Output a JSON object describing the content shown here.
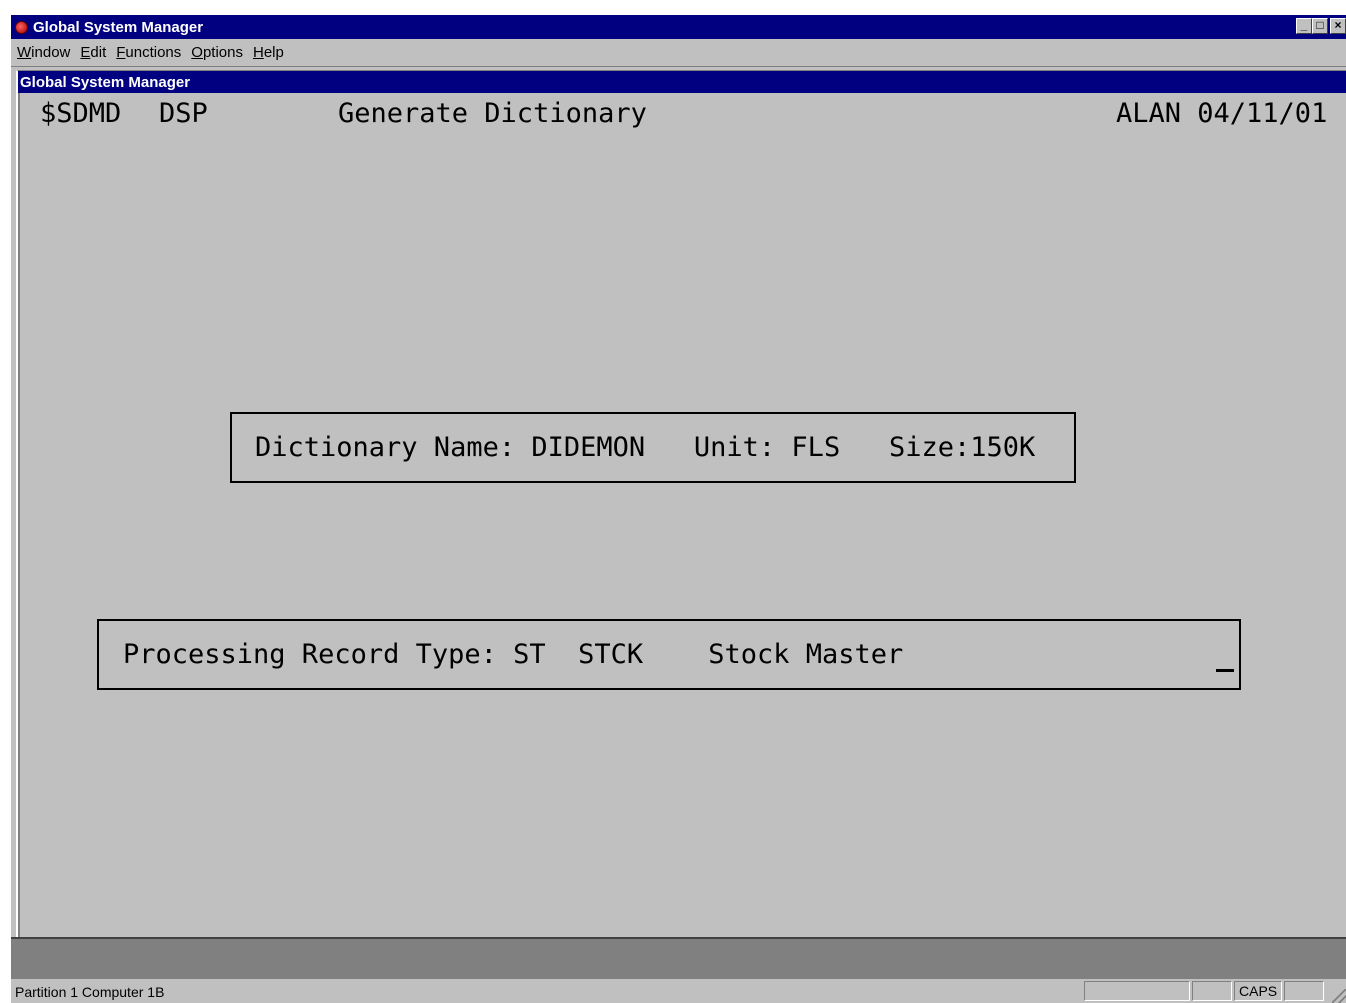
{
  "window": {
    "title": "Global System Manager",
    "buttons": {
      "minimize": "_",
      "maximize": "□",
      "close": "×"
    }
  },
  "menubar": [
    {
      "accel": "W",
      "rest": "indow"
    },
    {
      "accel": "E",
      "rest": "dit"
    },
    {
      "accel": "F",
      "rest": "unctions"
    },
    {
      "accel": "O",
      "rest": "ptions"
    },
    {
      "accel": "H",
      "rest": "elp"
    }
  ],
  "child": {
    "title": "Global System Manager"
  },
  "screen": {
    "program": "$SDMD",
    "mode": "DSP",
    "heading": "Generate Dictionary",
    "user_date": "ALAN 04/11/01",
    "dictionary_box": "Dictionary Name: DIDEMON   Unit: FLS   Size:150K",
    "processing_box": "Processing Record Type: ST  STCK    Stock Master"
  },
  "statusbar": {
    "text": "Partition 1 Computer 1B",
    "caps": "CAPS"
  }
}
